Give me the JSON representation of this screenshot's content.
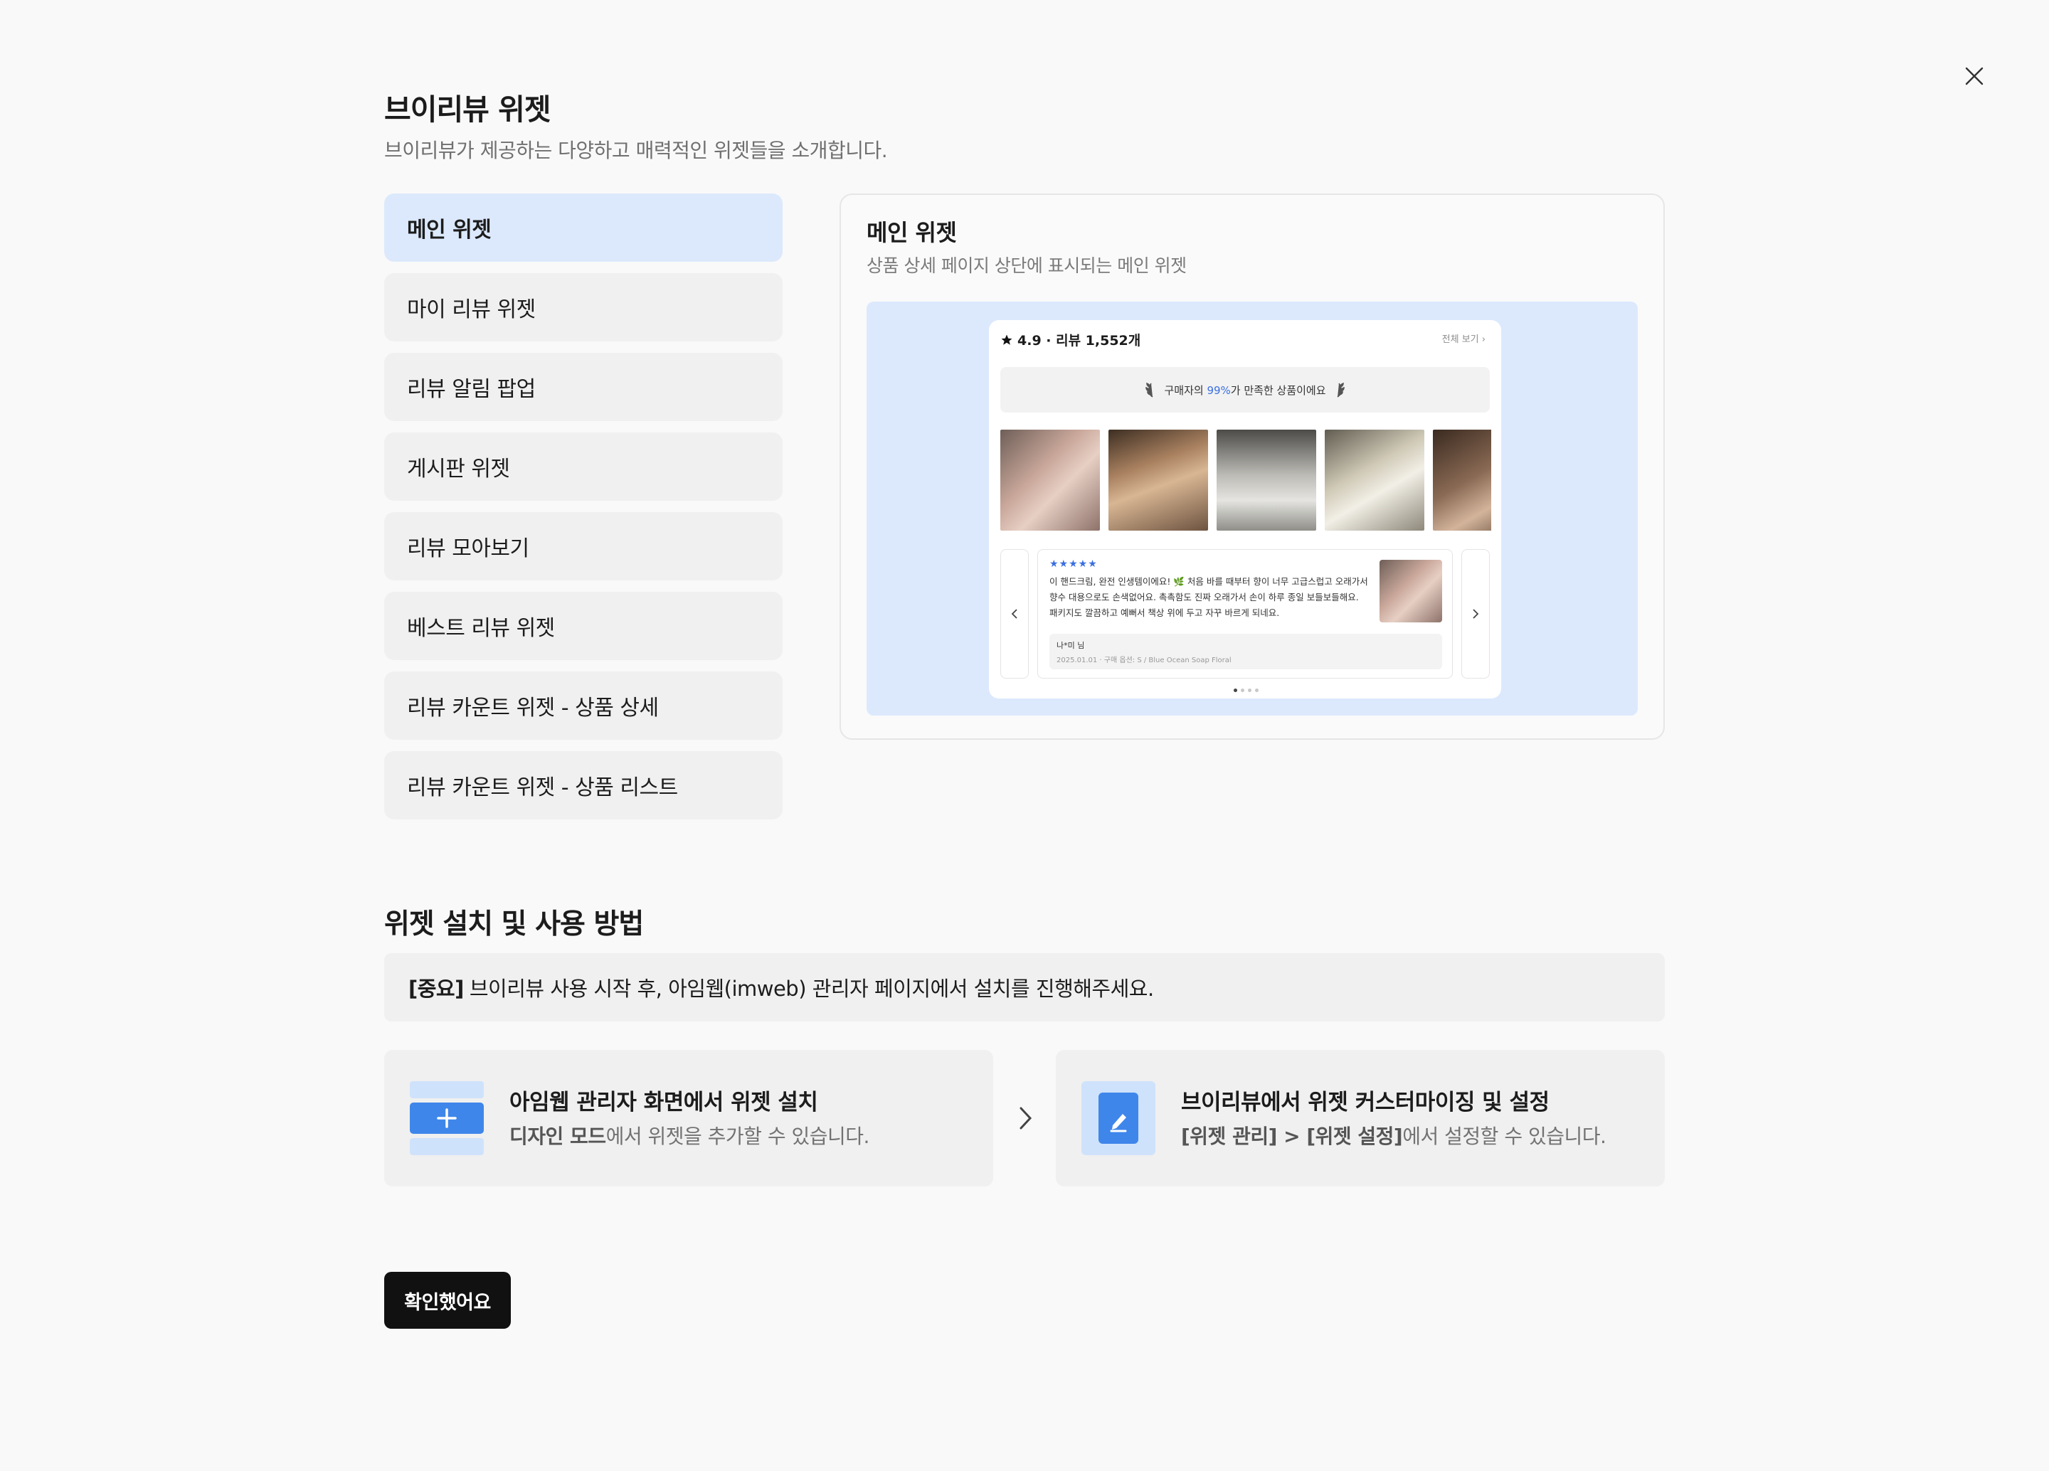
{
  "header": {
    "title": "브이리뷰 위젯",
    "subtitle": "브이리뷰가 제공하는 다양하고 매력적인 위젯들을 소개합니다."
  },
  "menu": {
    "selected": "메인 위젯",
    "items": [
      {
        "label": "메인 위젯"
      },
      {
        "label": "마이 리뷰 위젯"
      },
      {
        "label": "리뷰 알림 팝업"
      },
      {
        "label": "게시판 위젯"
      },
      {
        "label": "리뷰 모아보기"
      },
      {
        "label": "베스트 리뷰 위젯"
      },
      {
        "label": "리뷰 카운트 위젯 - 상품 상세"
      },
      {
        "label": "리뷰 카운트 위젯 - 상품 리스트"
      }
    ]
  },
  "preview": {
    "title": "메인 위젯",
    "description": "상품 상세 페이지 상단에 표시되는 메인 위젯",
    "widget": {
      "rating": "4.9 · 리뷰 1,552개",
      "view_all": "전체 보기",
      "banner_prefix": "구매자의 ",
      "banner_pct": "99%",
      "banner_suffix": "가 만족한 상품이에요",
      "stars": "★★★★★",
      "review_text": "이 핸드크림, 완전 인생템이에요! 🌿 처음 바를 때부터 향이 너무 고급스럽고 오래가서 향수 대용으로도 손색없어요. 촉촉함도 진짜 오래가서 손이 하루 종일 보들보들해요. 패키지도 깔끔하고 예뻐서 책상 위에 두고 자꾸 바르게 되네요.",
      "reviewer": "나*미 님",
      "review_meta": "2025.01.01 · 구매 옵션: S / Blue Ocean Soap Floral"
    }
  },
  "install": {
    "section_title": "위젯 설치 및 사용 방법",
    "notice_bold": "[중요]",
    "notice_text": "브이리뷰 사용 시작 후, 아임웹(imweb) 관리자 페이지에서 설치를 진행해주세요.",
    "steps": [
      {
        "title": "아임웹 관리자 화면에서 위젯 설치",
        "desc_strong": "디자인 모드",
        "desc": "에서 위젯을 추가할 수 있습니다.",
        "icon": "add-widget-icon"
      },
      {
        "title": "브이리뷰에서 위젯 커스터마이징 및 설정",
        "desc_strong": "[위젯 관리] > [위젯 설정]",
        "desc": "에서 설정할 수 있습니다.",
        "icon": "edit-icon"
      }
    ]
  },
  "footer": {
    "confirm_label": "확인했어요"
  },
  "colors": {
    "accent": "#3b6fe0",
    "selected_bg": "#dce9fc",
    "button_bg": "#111111"
  }
}
